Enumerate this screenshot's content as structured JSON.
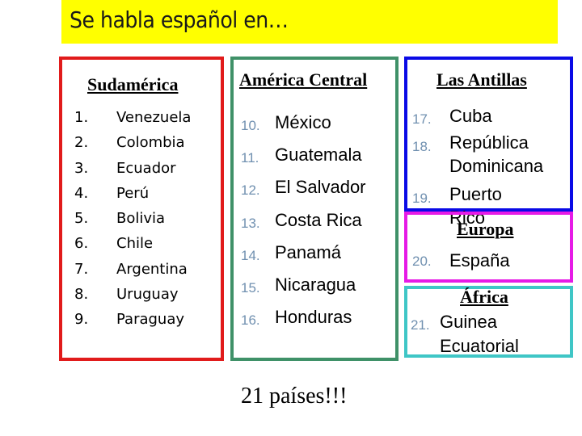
{
  "title": "Se habla español en…",
  "regions": {
    "sudamerica": {
      "heading": "Sudamérica",
      "items": [
        {
          "num": "1.",
          "name": "Venezuela"
        },
        {
          "num": "2.",
          "name": "Colombia"
        },
        {
          "num": "3.",
          "name": "Ecuador"
        },
        {
          "num": "4.",
          "name": "Perú"
        },
        {
          "num": "5.",
          "name": "Bolivia"
        },
        {
          "num": "6.",
          "name": "Chile"
        },
        {
          "num": "7.",
          "name": "Argentina"
        },
        {
          "num": "8.",
          "name": "Uruguay"
        },
        {
          "num": "9.",
          "name": "Paraguay"
        }
      ]
    },
    "central": {
      "heading": "América Central",
      "items": [
        {
          "num": "10.",
          "name": "México"
        },
        {
          "num": "11.",
          "name": "Guatemala"
        },
        {
          "num": "12.",
          "name": "El Salvador"
        },
        {
          "num": "13.",
          "name": "Costa Rica"
        },
        {
          "num": "14.",
          "name": "Panamá"
        },
        {
          "num": "15.",
          "name": "Nicaragua"
        },
        {
          "num": "16.",
          "name": "Honduras"
        }
      ]
    },
    "antillas": {
      "heading": "Las Antillas",
      "items": [
        {
          "num": "17.",
          "name": "Cuba"
        },
        {
          "num": "18.",
          "name": "República",
          "name2": "Dominicana"
        },
        {
          "num": "19.",
          "name": "Puerto",
          "name2": "Rico"
        }
      ]
    },
    "europa": {
      "heading": "Europa",
      "items": [
        {
          "num": "20.",
          "name": "España"
        }
      ]
    },
    "africa": {
      "heading": "África",
      "items": [
        {
          "num": "21.",
          "name": "Guinea",
          "name2": "Ecuatorial"
        }
      ]
    }
  },
  "footer": "21 países!!!",
  "colors": {
    "title_bg": "#ffff00",
    "sudamerica_border": "#e11b1b",
    "central_border": "#3f9168",
    "antillas_border": "#0a0ae6",
    "europa_border": "#e61ae6",
    "africa_border": "#3fc6c6",
    "number_color": "#7090b0"
  }
}
